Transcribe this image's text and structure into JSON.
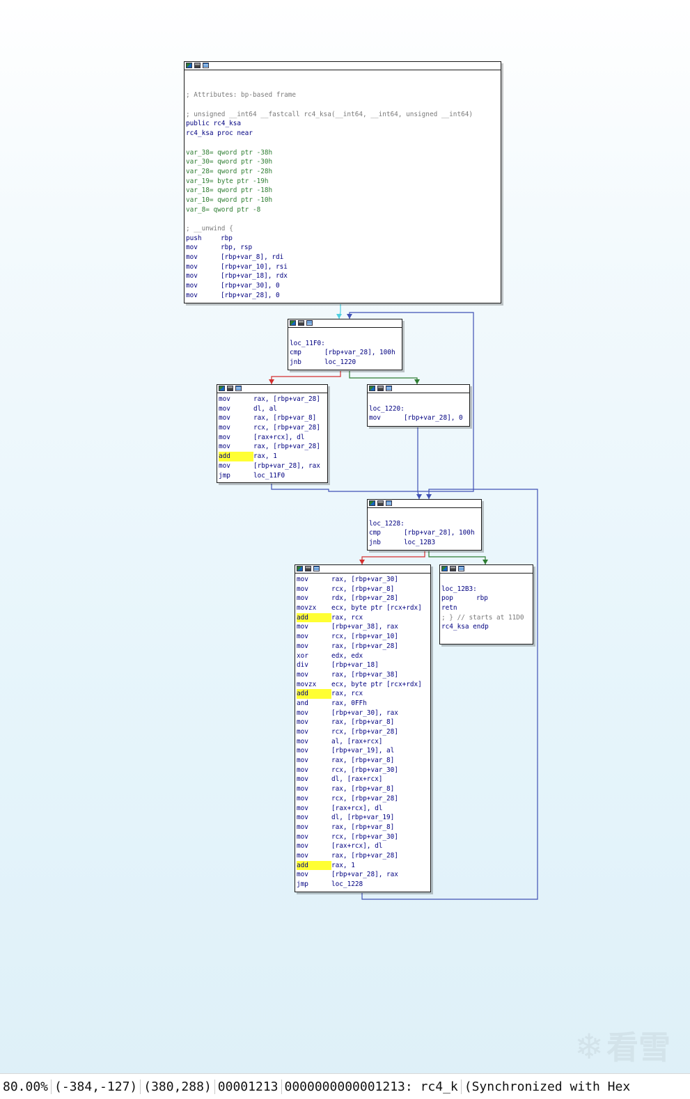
{
  "window": {
    "title": ""
  },
  "graph": {
    "nodes": [
      {
        "id": "entry",
        "lines": [
          {
            "t": "blank"
          },
          {
            "t": "blank"
          },
          {
            "t": "cmt",
            "text": "; Attributes: bp-based frame"
          },
          {
            "t": "blank"
          },
          {
            "t": "cmt",
            "text": "; unsigned __int64 __fastcall rc4_ksa(__int64, __int64, unsigned __int64)"
          },
          {
            "t": "lbl",
            "text": "public rc4_ksa"
          },
          {
            "t": "lbl",
            "text": "rc4_ksa proc near"
          },
          {
            "t": "blank"
          },
          {
            "t": "dcl",
            "text": "var_38= qword ptr -38h"
          },
          {
            "t": "dcl",
            "text": "var_30= qword ptr -30h"
          },
          {
            "t": "dcl",
            "text": "var_28= qword ptr -28h"
          },
          {
            "t": "dcl",
            "text": "var_19= byte ptr -19h"
          },
          {
            "t": "dcl",
            "text": "var_18= qword ptr -18h"
          },
          {
            "t": "dcl",
            "text": "var_10= qword ptr -10h"
          },
          {
            "t": "dcl",
            "text": "var_8= qword ptr -8"
          },
          {
            "t": "blank"
          },
          {
            "t": "cmt",
            "text": "; __unwind {"
          },
          {
            "t": "ins",
            "m": "push",
            "o": "rbp"
          },
          {
            "t": "ins",
            "m": "mov",
            "o": "rbp, rsp"
          },
          {
            "t": "ins",
            "m": "mov",
            "o": "[rbp+var_8], rdi"
          },
          {
            "t": "ins",
            "m": "mov",
            "o": "[rbp+var_10], rsi"
          },
          {
            "t": "ins",
            "m": "mov",
            "o": "[rbp+var_18], rdx"
          },
          {
            "t": "ins",
            "m": "mov",
            "o": "[rbp+var_30], 0"
          },
          {
            "t": "ins",
            "m": "mov",
            "o": "[rbp+var_28], 0"
          }
        ]
      },
      {
        "id": "loc_11F0",
        "lines": [
          {
            "t": "blank"
          },
          {
            "t": "lbl",
            "text": "loc_11F0:"
          },
          {
            "t": "ins",
            "m": "cmp",
            "o": "[rbp+var_28], 100h"
          },
          {
            "t": "ins",
            "m": "jnb",
            "o": "loc_1220"
          }
        ]
      },
      {
        "id": "init_loop",
        "lines": [
          {
            "t": "ins",
            "m": "mov",
            "o": "rax, [rbp+var_28]"
          },
          {
            "t": "ins",
            "m": "mov",
            "o": "dl, al"
          },
          {
            "t": "ins",
            "m": "mov",
            "o": "rax, [rbp+var_8]"
          },
          {
            "t": "ins",
            "m": "mov",
            "o": "rcx, [rbp+var_28]"
          },
          {
            "t": "ins",
            "m": "mov",
            "o": "[rax+rcx], dl"
          },
          {
            "t": "ins",
            "m": "mov",
            "o": "rax, [rbp+var_28]"
          },
          {
            "t": "ins",
            "m": "add",
            "o": "rax, 1",
            "hl": true
          },
          {
            "t": "ins",
            "m": "mov",
            "o": "[rbp+var_28], rax"
          },
          {
            "t": "ins",
            "m": "jmp",
            "o": "loc_11F0"
          }
        ]
      },
      {
        "id": "loc_1220",
        "lines": [
          {
            "t": "blank"
          },
          {
            "t": "lbl",
            "text": "loc_1220:"
          },
          {
            "t": "ins",
            "m": "mov",
            "o": "[rbp+var_28], 0"
          }
        ]
      },
      {
        "id": "loc_1228",
        "lines": [
          {
            "t": "blank"
          },
          {
            "t": "lbl",
            "text": "loc_1228:"
          },
          {
            "t": "ins",
            "m": "cmp",
            "o": "[rbp+var_28], 100h"
          },
          {
            "t": "ins",
            "m": "jnb",
            "o": "loc_12B3"
          }
        ]
      },
      {
        "id": "swap_loop",
        "lines": [
          {
            "t": "ins",
            "m": "mov",
            "o": "rax, [rbp+var_30]"
          },
          {
            "t": "ins",
            "m": "mov",
            "o": "rcx, [rbp+var_8]"
          },
          {
            "t": "ins",
            "m": "mov",
            "o": "rdx, [rbp+var_28]"
          },
          {
            "t": "ins",
            "m": "movzx",
            "o": "ecx, byte ptr [rcx+rdx]"
          },
          {
            "t": "ins",
            "m": "add",
            "o": "rax, rcx",
            "hl": true
          },
          {
            "t": "ins",
            "m": "mov",
            "o": "[rbp+var_38], rax"
          },
          {
            "t": "ins",
            "m": "mov",
            "o": "rcx, [rbp+var_10]"
          },
          {
            "t": "ins",
            "m": "mov",
            "o": "rax, [rbp+var_28]"
          },
          {
            "t": "ins",
            "m": "xor",
            "o": "edx, edx"
          },
          {
            "t": "ins",
            "m": "div",
            "o": "[rbp+var_18]"
          },
          {
            "t": "ins",
            "m": "mov",
            "o": "rax, [rbp+var_38]"
          },
          {
            "t": "ins",
            "m": "movzx",
            "o": "ecx, byte ptr [rcx+rdx]"
          },
          {
            "t": "ins",
            "m": "add",
            "o": "rax, rcx",
            "hl": true
          },
          {
            "t": "ins",
            "m": "and",
            "o": "rax, 0FFh"
          },
          {
            "t": "ins",
            "m": "mov",
            "o": "[rbp+var_30], rax"
          },
          {
            "t": "ins",
            "m": "mov",
            "o": "rax, [rbp+var_8]"
          },
          {
            "t": "ins",
            "m": "mov",
            "o": "rcx, [rbp+var_28]"
          },
          {
            "t": "ins",
            "m": "mov",
            "o": "al, [rax+rcx]"
          },
          {
            "t": "ins",
            "m": "mov",
            "o": "[rbp+var_19], al"
          },
          {
            "t": "ins",
            "m": "mov",
            "o": "rax, [rbp+var_8]"
          },
          {
            "t": "ins",
            "m": "mov",
            "o": "rcx, [rbp+var_30]"
          },
          {
            "t": "ins",
            "m": "mov",
            "o": "dl, [rax+rcx]"
          },
          {
            "t": "ins",
            "m": "mov",
            "o": "rax, [rbp+var_8]"
          },
          {
            "t": "ins",
            "m": "mov",
            "o": "rcx, [rbp+var_28]"
          },
          {
            "t": "ins",
            "m": "mov",
            "o": "[rax+rcx], dl"
          },
          {
            "t": "ins",
            "m": "mov",
            "o": "dl, [rbp+var_19]"
          },
          {
            "t": "ins",
            "m": "mov",
            "o": "rax, [rbp+var_8]"
          },
          {
            "t": "ins",
            "m": "mov",
            "o": "rcx, [rbp+var_30]"
          },
          {
            "t": "ins",
            "m": "mov",
            "o": "[rax+rcx], dl"
          },
          {
            "t": "ins",
            "m": "mov",
            "o": "rax, [rbp+var_28]"
          },
          {
            "t": "ins",
            "m": "add",
            "o": "rax, 1",
            "hl": true
          },
          {
            "t": "ins",
            "m": "mov",
            "o": "[rbp+var_28], rax"
          },
          {
            "t": "ins",
            "m": "jmp",
            "o": "loc_1228"
          }
        ]
      },
      {
        "id": "loc_12B3",
        "lines": [
          {
            "t": "blank"
          },
          {
            "t": "lbl",
            "text": "loc_12B3:"
          },
          {
            "t": "ins",
            "m": "pop",
            "o": "rbp"
          },
          {
            "t": "ins",
            "m": "retn",
            "o": ""
          },
          {
            "t": "cmt",
            "text": "; } // starts at 11D0"
          },
          {
            "t": "lbl",
            "text": "rc4_ksa endp"
          }
        ]
      }
    ],
    "edge_colors": {
      "taken": "#2e7d32",
      "not_taken": "#d32f2f",
      "unconditional": "#3f51b5",
      "back": "#4dd0e1"
    }
  },
  "status_bar": {
    "zoom": "80.00%",
    "cursor_pos": "(-384,-127)",
    "graph_pos": "(380,288)",
    "file_offset": "00001213",
    "location": "0000000000001213: rc4_k",
    "sync": "(Synchronized with Hex"
  },
  "watermark": {
    "icon": "snowflake-icon",
    "text": "看雪"
  }
}
